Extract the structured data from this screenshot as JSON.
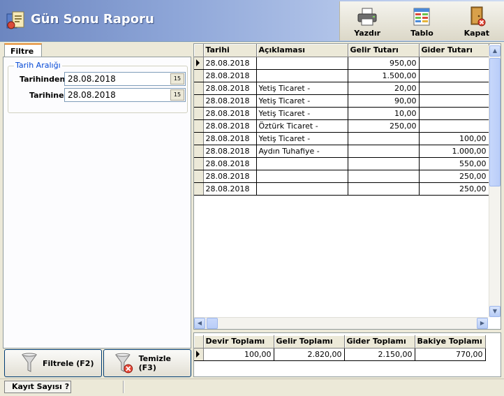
{
  "window": {
    "title": "Gün Sonu Raporu"
  },
  "toolbar": {
    "print_label": "Yazdır",
    "table_label": "Tablo",
    "close_label": "Kapat"
  },
  "filter": {
    "tab_label": "Filtre",
    "group_label": "Tarih Aralığı",
    "from_label": "Tarihinden",
    "from_value": "28.08.2018",
    "to_label": "Tarihine",
    "to_value": "28.08.2018",
    "calendar_glyph": "15",
    "apply_label": "Filtrele (F2)",
    "clear_label": "Temizle (F3)"
  },
  "grid": {
    "columns": [
      "Tarihi",
      "Açıklaması",
      "Gelir Tutarı",
      "Gider Tutarı"
    ],
    "rows": [
      [
        "28.08.2018",
        "",
        "950,00",
        ""
      ],
      [
        "28.08.2018",
        "",
        "1.500,00",
        ""
      ],
      [
        "28.08.2018",
        "Yetiş Ticaret -",
        "20,00",
        ""
      ],
      [
        "28.08.2018",
        "Yetiş Ticaret -",
        "90,00",
        ""
      ],
      [
        "28.08.2018",
        "Yetiş Ticaret -",
        "10,00",
        ""
      ],
      [
        "28.08.2018",
        "Öztürk Ticaret -",
        "250,00",
        ""
      ],
      [
        "28.08.2018",
        "Yetiş Ticaret -",
        "",
        "100,00"
      ],
      [
        "28.08.2018",
        "Aydın Tuhafiye -",
        "",
        "1.000,00"
      ],
      [
        "28.08.2018",
        "",
        "",
        "550,00"
      ],
      [
        "28.08.2018",
        "",
        "",
        "250,00"
      ],
      [
        "28.08.2018",
        "",
        "",
        "250,00"
      ]
    ]
  },
  "totals": {
    "columns": [
      "Devir Toplamı",
      "Gelir Toplamı",
      "Gider Toplamı",
      "Bakiye Toplamı"
    ],
    "values": [
      "100,00",
      "2.820,00",
      "2.150,00",
      "770,00"
    ]
  },
  "status": {
    "record_count_label": "Kayıt Sayısı ?"
  },
  "colors": {
    "header_start": "#6c86c0",
    "header_end": "#cfdcf3",
    "group_label": "#0046d5"
  }
}
